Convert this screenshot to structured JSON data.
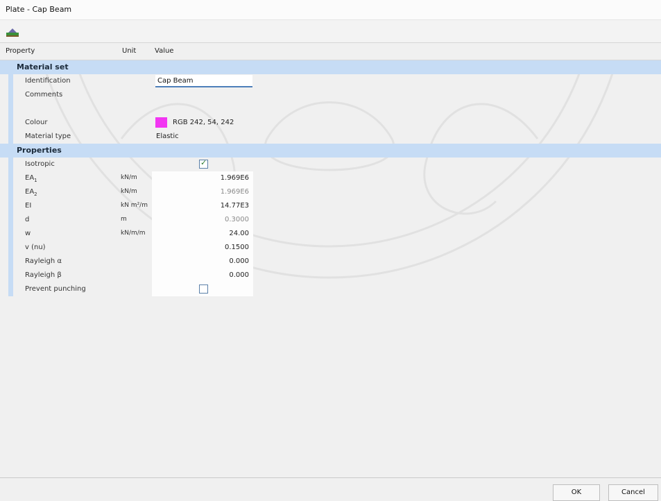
{
  "window": {
    "title": "Plate - Cap Beam"
  },
  "toolbar": {
    "icon": "plate-icon"
  },
  "columns": {
    "property": "Property",
    "unit": "Unit",
    "value": "Value"
  },
  "groups": {
    "material_set": "Material set",
    "properties": "Properties"
  },
  "material_set": {
    "identification": {
      "label": "Identification",
      "value": "Cap Beam"
    },
    "comments": {
      "label": "Comments",
      "value": ""
    },
    "colour": {
      "label": "Colour",
      "value": "RGB 242, 54, 242",
      "swatch": "#f236f2"
    },
    "material_type": {
      "label": "Material type",
      "value": "Elastic"
    }
  },
  "properties": {
    "isotropic": {
      "label": "Isotropic",
      "checked": true
    },
    "ea1": {
      "label_main": "EA",
      "label_sub": "1",
      "unit": "kN/m",
      "value": "1.969E6"
    },
    "ea2": {
      "label_main": "EA",
      "label_sub": "2",
      "unit": "kN/m",
      "value": "1.969E6"
    },
    "ei": {
      "label": "EI",
      "unit": "kN m²/m",
      "value": "14.77E3"
    },
    "d": {
      "label": "d",
      "unit": "m",
      "value": "0.3000"
    },
    "w": {
      "label": "w",
      "unit": "kN/m/m",
      "value": "24.00"
    },
    "nu": {
      "label": "v (nu)",
      "value": "0.1500"
    },
    "rayleigh_alpha": {
      "label": "Rayleigh α",
      "value": "0.000"
    },
    "rayleigh_beta": {
      "label": "Rayleigh β",
      "value": "0.000"
    },
    "prevent_punching": {
      "label": "Prevent punching",
      "checked": false
    }
  },
  "footer": {
    "ok": "OK",
    "cancel": "Cancel"
  }
}
